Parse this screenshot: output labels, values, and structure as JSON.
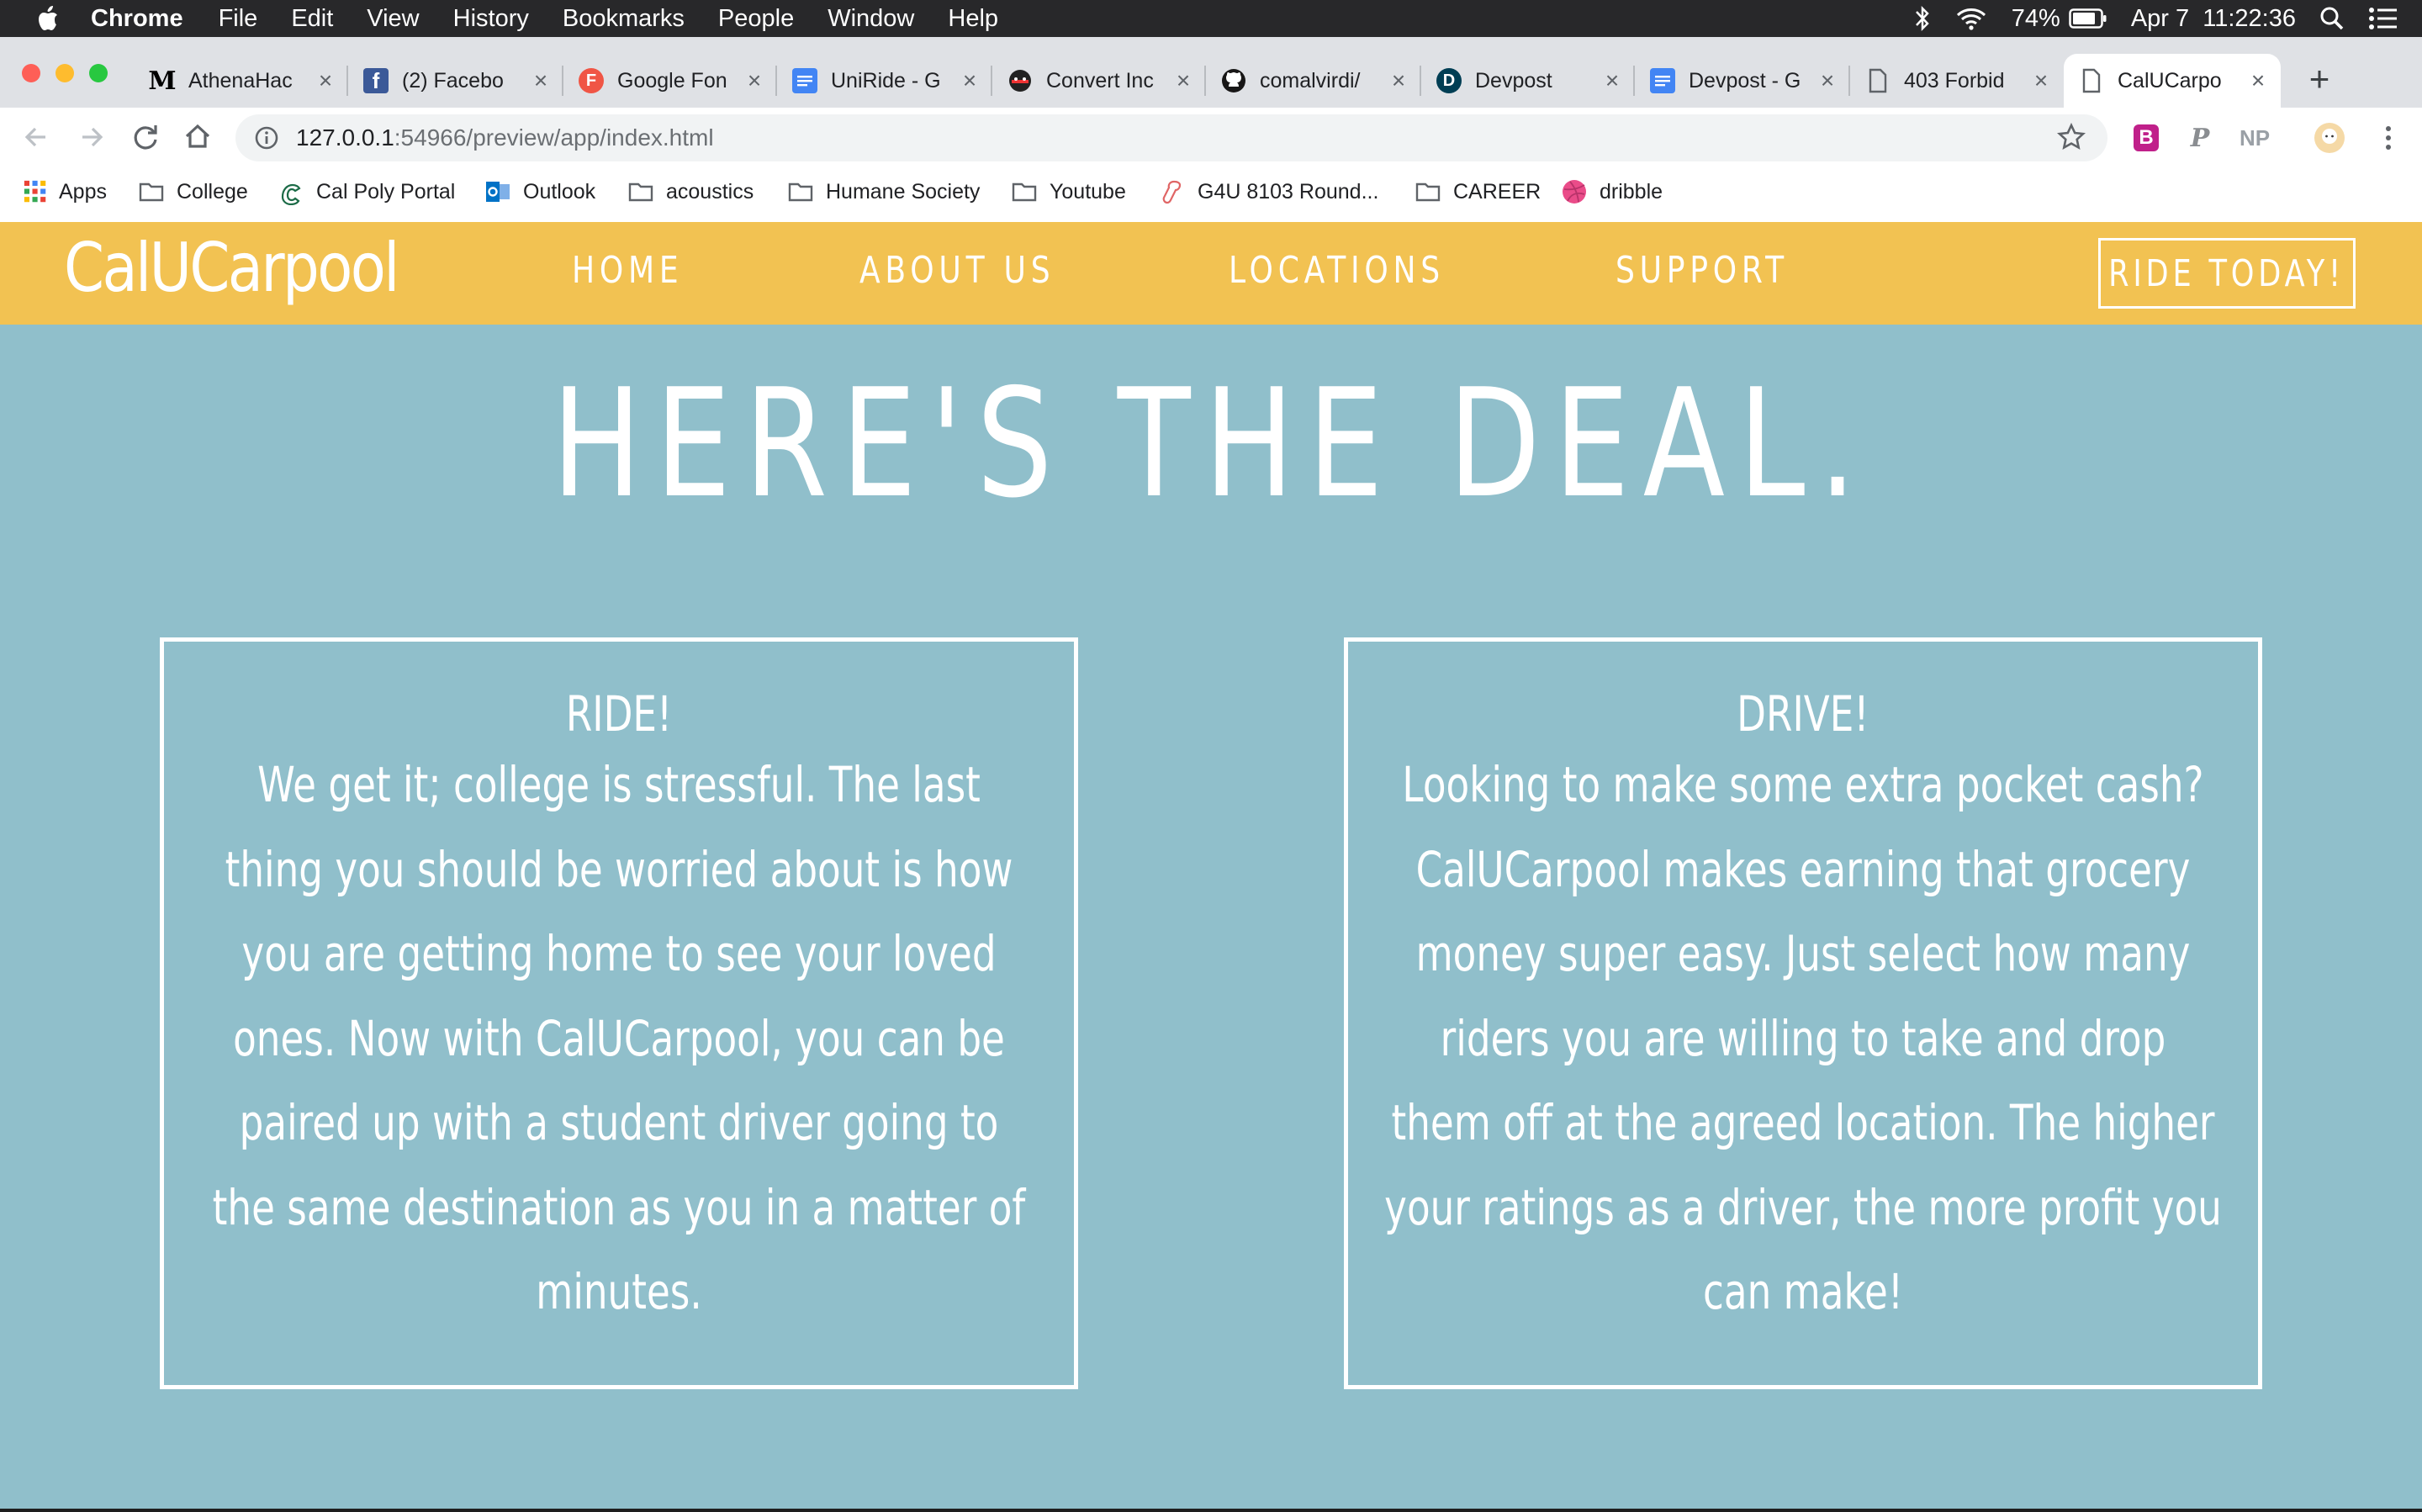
{
  "menubar": {
    "app_name": "Chrome",
    "items": [
      "File",
      "Edit",
      "View",
      "History",
      "Bookmarks",
      "People",
      "Window",
      "Help"
    ],
    "battery": "74%",
    "datetime": "Apr 7  11:22:36"
  },
  "tabs": [
    {
      "title": "AthenaHac",
      "icon": "medium-icon"
    },
    {
      "title": "(2) Facebo",
      "icon": "facebook-icon"
    },
    {
      "title": "Google Fon",
      "icon": "google-fonts-icon"
    },
    {
      "title": "UniRide - G",
      "icon": "google-docs-icon"
    },
    {
      "title": "Convert Inc",
      "icon": "convert-icon"
    },
    {
      "title": "comalvirdi/",
      "icon": "github-icon"
    },
    {
      "title": "Devpost",
      "icon": "devpost-icon"
    },
    {
      "title": "Devpost - G",
      "icon": "google-docs-icon"
    },
    {
      "title": "403 Forbid",
      "icon": "document-icon"
    },
    {
      "title": "CalUCarpo",
      "icon": "document-icon",
      "active": true
    }
  ],
  "address_bar": {
    "host": "127.0.0.1",
    "rest": ":54966/preview/app/index.html"
  },
  "extensions": [
    "B",
    "P",
    "NP"
  ],
  "bookmarks": [
    {
      "label": "Apps",
      "icon": "apps-grid-icon"
    },
    {
      "label": "College",
      "icon": "folder-icon"
    },
    {
      "label": "Cal Poly Portal",
      "icon": "cal-poly-icon"
    },
    {
      "label": "Outlook",
      "icon": "outlook-icon"
    },
    {
      "label": "acoustics",
      "icon": "folder-icon"
    },
    {
      "label": "Humane Society",
      "icon": "folder-icon"
    },
    {
      "label": "Youtube",
      "icon": "folder-icon"
    },
    {
      "label": "G4U 8103 Round...",
      "icon": "link-icon"
    },
    {
      "label": "CAREER",
      "icon": "folder-icon"
    },
    {
      "label": "dribble",
      "icon": "dribbble-icon"
    }
  ],
  "site": {
    "logo": "CalUCarpool",
    "nav": [
      "HOME",
      "ABOUT US",
      "LOCATIONS",
      "SUPPORT"
    ],
    "cta": "RIDE TODAY!",
    "headline": "HERE'S THE DEAL.",
    "colors": {
      "nav": "#f2c252",
      "background": "#90bfcb",
      "text": "#ffffff"
    },
    "cards": [
      {
        "title": "RIDE!",
        "lines": [
          "We get it; college is stressful. The last",
          "thing you should be worried about is how",
          "you are getting home to see your loved",
          "ones. Now with CalUCarpool, you can be",
          "paired up with a student driver going to",
          "the same destination as you in a matter of",
          "minutes."
        ]
      },
      {
        "title": "DRIVE!",
        "lines": [
          "Looking to make some extra pocket cash?",
          "CalUCarpool makes earning that grocery",
          "money super easy. Just select how many",
          "riders you are willing to take and drop",
          "them off at the agreed location. The higher",
          "your ratings as a driver, the more profit you",
          "can make!"
        ]
      }
    ]
  }
}
